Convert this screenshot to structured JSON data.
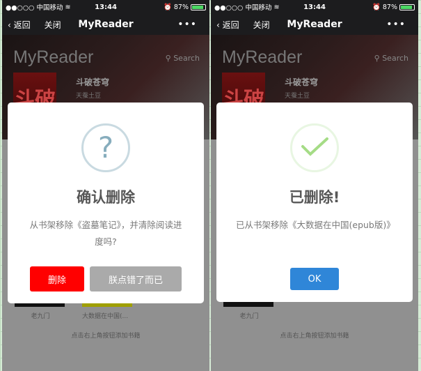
{
  "phones": [
    {
      "status": {
        "carrier": "●●○○○ 中国移动",
        "wifi": "wifi-icon",
        "time": "13:44",
        "battery": "87%",
        "battery_level": 87
      },
      "nav": {
        "back": "返回",
        "close": "关闭",
        "title": "MyReader",
        "more": "•••"
      },
      "brand": "MyReader",
      "search": "Search",
      "book": {
        "title": "斗破苍穹",
        "author": "天蚕土豆",
        "cover_text": "斗破"
      },
      "shelf": [
        "老九门",
        "大数据在中国(..."
      ],
      "hint": "点击右上角按钮添加书籍",
      "dialog": {
        "icon": "?",
        "title": "确认删除",
        "text": "从书架移除《盗墓笔记》，并清除阅读进度吗?",
        "confirm": "删除",
        "cancel": "朕点错了而已"
      }
    },
    {
      "status": {
        "carrier": "●●○○○ 中国移动",
        "wifi": "wifi-icon",
        "time": "13:44",
        "battery": "87%",
        "battery_level": 87
      },
      "nav": {
        "back": "返回",
        "close": "关闭",
        "title": "MyReader",
        "more": "•••"
      },
      "brand": "MyReader",
      "search": "Search",
      "book": {
        "title": "斗破苍穹",
        "author": "天蚕土豆",
        "cover_text": "斗破"
      },
      "shelf": [
        "老九门"
      ],
      "hint": "点击右上角按钮添加书籍",
      "dialog": {
        "title": "已删除!",
        "text": "已从书架移除《大数据在中国(epub版)》",
        "ok": "OK"
      }
    }
  ],
  "colors": {
    "danger": "#ff0000",
    "primary": "#2f86d8",
    "success": "#a5dc86"
  }
}
